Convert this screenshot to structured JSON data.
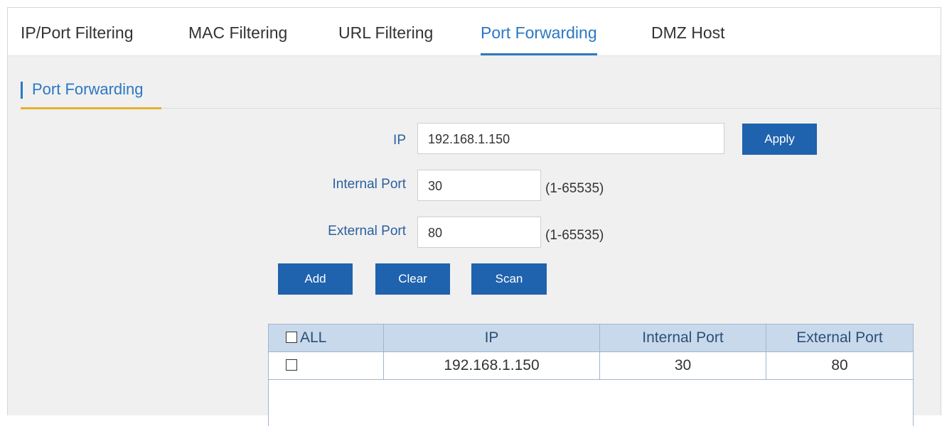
{
  "tabs": [
    {
      "label": "IP/Port Filtering"
    },
    {
      "label": "MAC Filtering"
    },
    {
      "label": "URL Filtering"
    },
    {
      "label": "Port Forwarding",
      "active": true
    },
    {
      "label": "DMZ Host"
    }
  ],
  "section": {
    "title": "Port Forwarding"
  },
  "form": {
    "ip_label": "IP",
    "ip_value": "192.168.1.150",
    "internal_port_label": "Internal Port",
    "internal_port_value": "30",
    "internal_port_hint": "(1-65535)",
    "external_port_label": "External Port",
    "external_port_value": "80",
    "external_port_hint": "(1-65535)"
  },
  "buttons": {
    "apply": "Apply",
    "add": "Add",
    "clear": "Clear",
    "scan": "Scan"
  },
  "table": {
    "headers": {
      "all": "ALL",
      "ip": "IP",
      "internal_port": "Internal Port",
      "external_port": "External Port"
    },
    "rows": [
      {
        "ip": "192.168.1.150",
        "internal_port": "30",
        "external_port": "80"
      }
    ]
  },
  "colors": {
    "accent": "#2b78c2",
    "button": "#1f62ad",
    "section_underline": "#e6b030",
    "table_header": "#c8d9eb"
  }
}
